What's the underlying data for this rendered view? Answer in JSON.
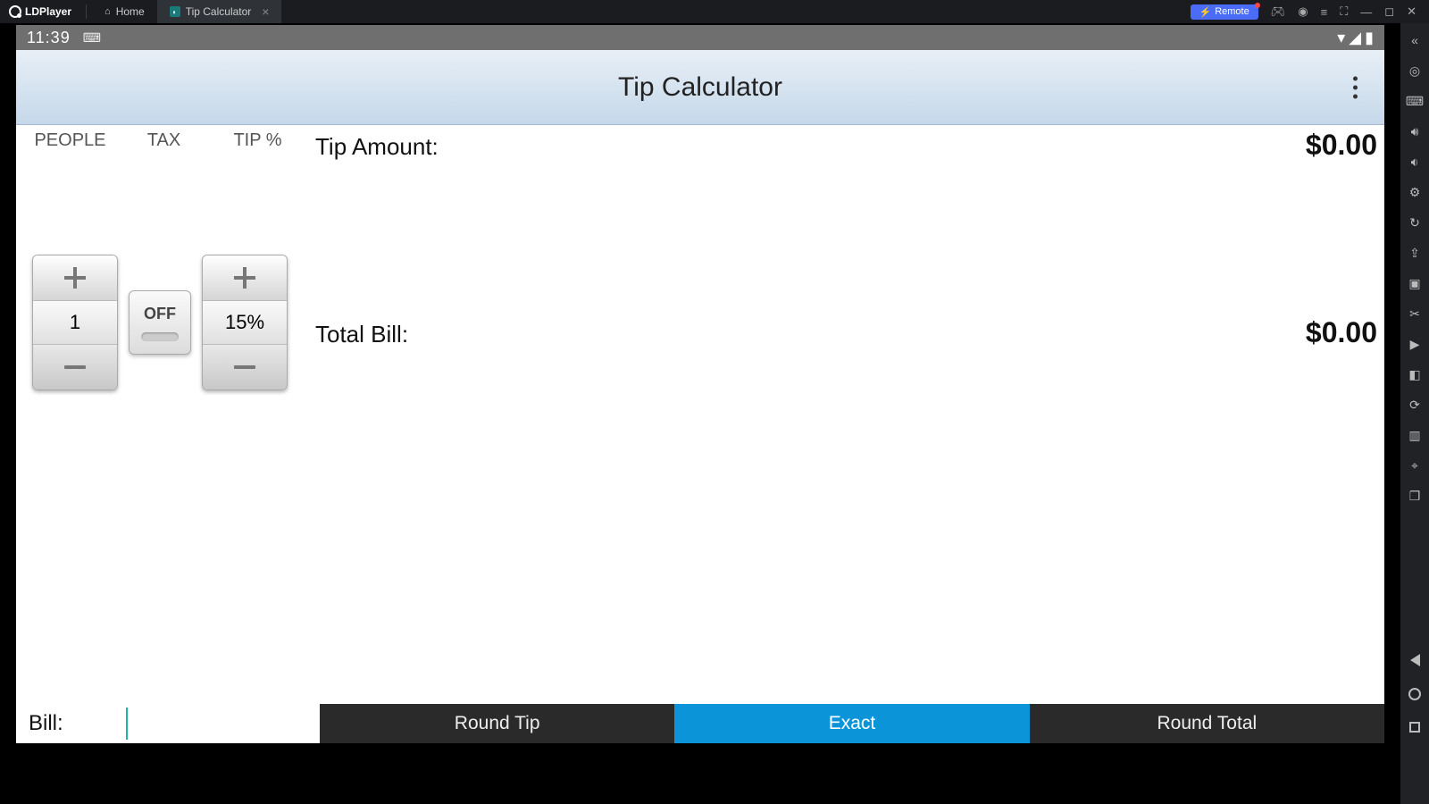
{
  "titlebar": {
    "logo": "LDPlayer",
    "home_tab": "Home",
    "app_tab": "Tip Calculator",
    "remote": "Remote"
  },
  "status": {
    "time": "11:39"
  },
  "app": {
    "title": "Tip Calculator",
    "headers": {
      "people": "PEOPLE",
      "tax": "TAX",
      "tip": "TIP %"
    },
    "tip_amount_label": "Tip Amount:",
    "tip_amount_value": "$0.00",
    "people_value": "1",
    "tax_toggle": "OFF",
    "tip_value": "15%",
    "total_label": "Total Bill:",
    "total_value": "$0.00",
    "bill_label": "Bill:",
    "buttons": {
      "round_tip": "Round Tip",
      "exact": "Exact",
      "round_total": "Round Total"
    }
  }
}
